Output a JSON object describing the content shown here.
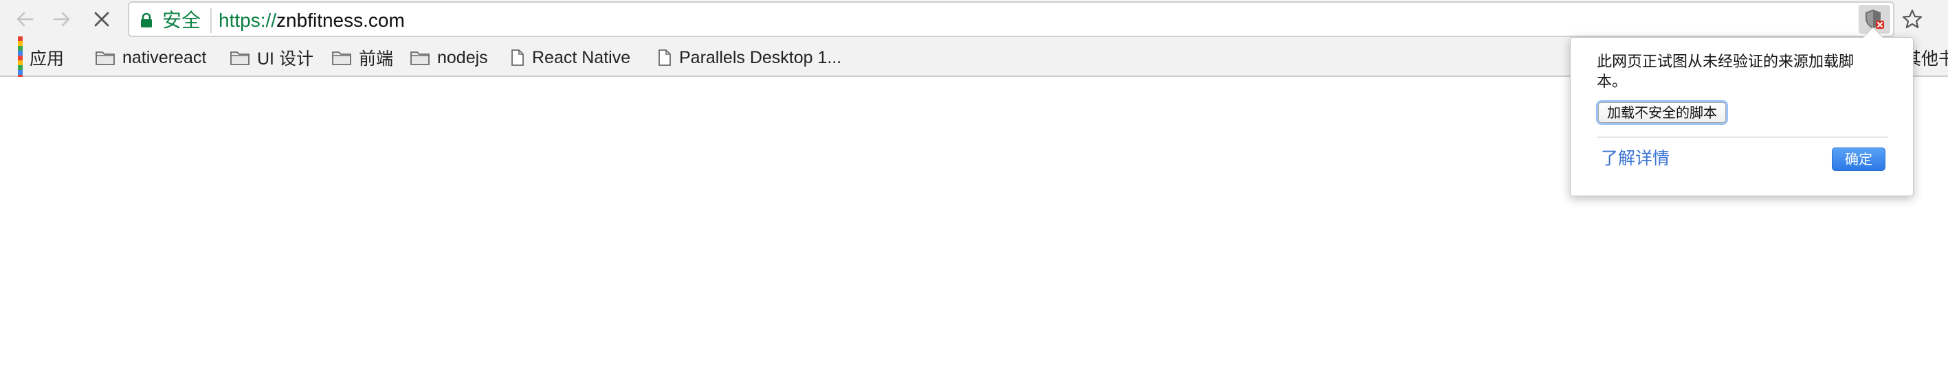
{
  "toolbar": {
    "security_label": "安全",
    "url_scheme": "https://",
    "url_rest": "znbfitness.com",
    "icons": {
      "back": "back-arrow-icon",
      "forward": "forward-arrow-icon",
      "stop": "stop-loading-icon",
      "lock": "lock-icon",
      "shield": "blocked-script-shield-icon",
      "star": "bookmark-star-icon"
    },
    "colors": {
      "secure_green": "#0b8043",
      "blocked_red": "#d93025"
    }
  },
  "bookmarks": {
    "items": [
      {
        "label": "应用",
        "icon": "apps-grid-icon"
      },
      {
        "label": "nativereact",
        "icon": "folder-icon"
      },
      {
        "label": "UI 设计",
        "icon": "folder-icon"
      },
      {
        "label": "前端",
        "icon": "folder-icon"
      },
      {
        "label": "nodejs",
        "icon": "folder-icon"
      },
      {
        "label": "React Native",
        "icon": "page-icon"
      },
      {
        "label": "Parallels Desktop 1...",
        "icon": "page-icon"
      }
    ],
    "overflow_label": "其他书"
  },
  "popup": {
    "message": "此网页正试图从未经验证的来源加载脚本。",
    "load_button": "加载不安全的脚本",
    "learn_more": "了解详情",
    "ok_button": "确定",
    "colors": {
      "link": "#3a75d4",
      "ok_button": "#2b79e5"
    }
  }
}
